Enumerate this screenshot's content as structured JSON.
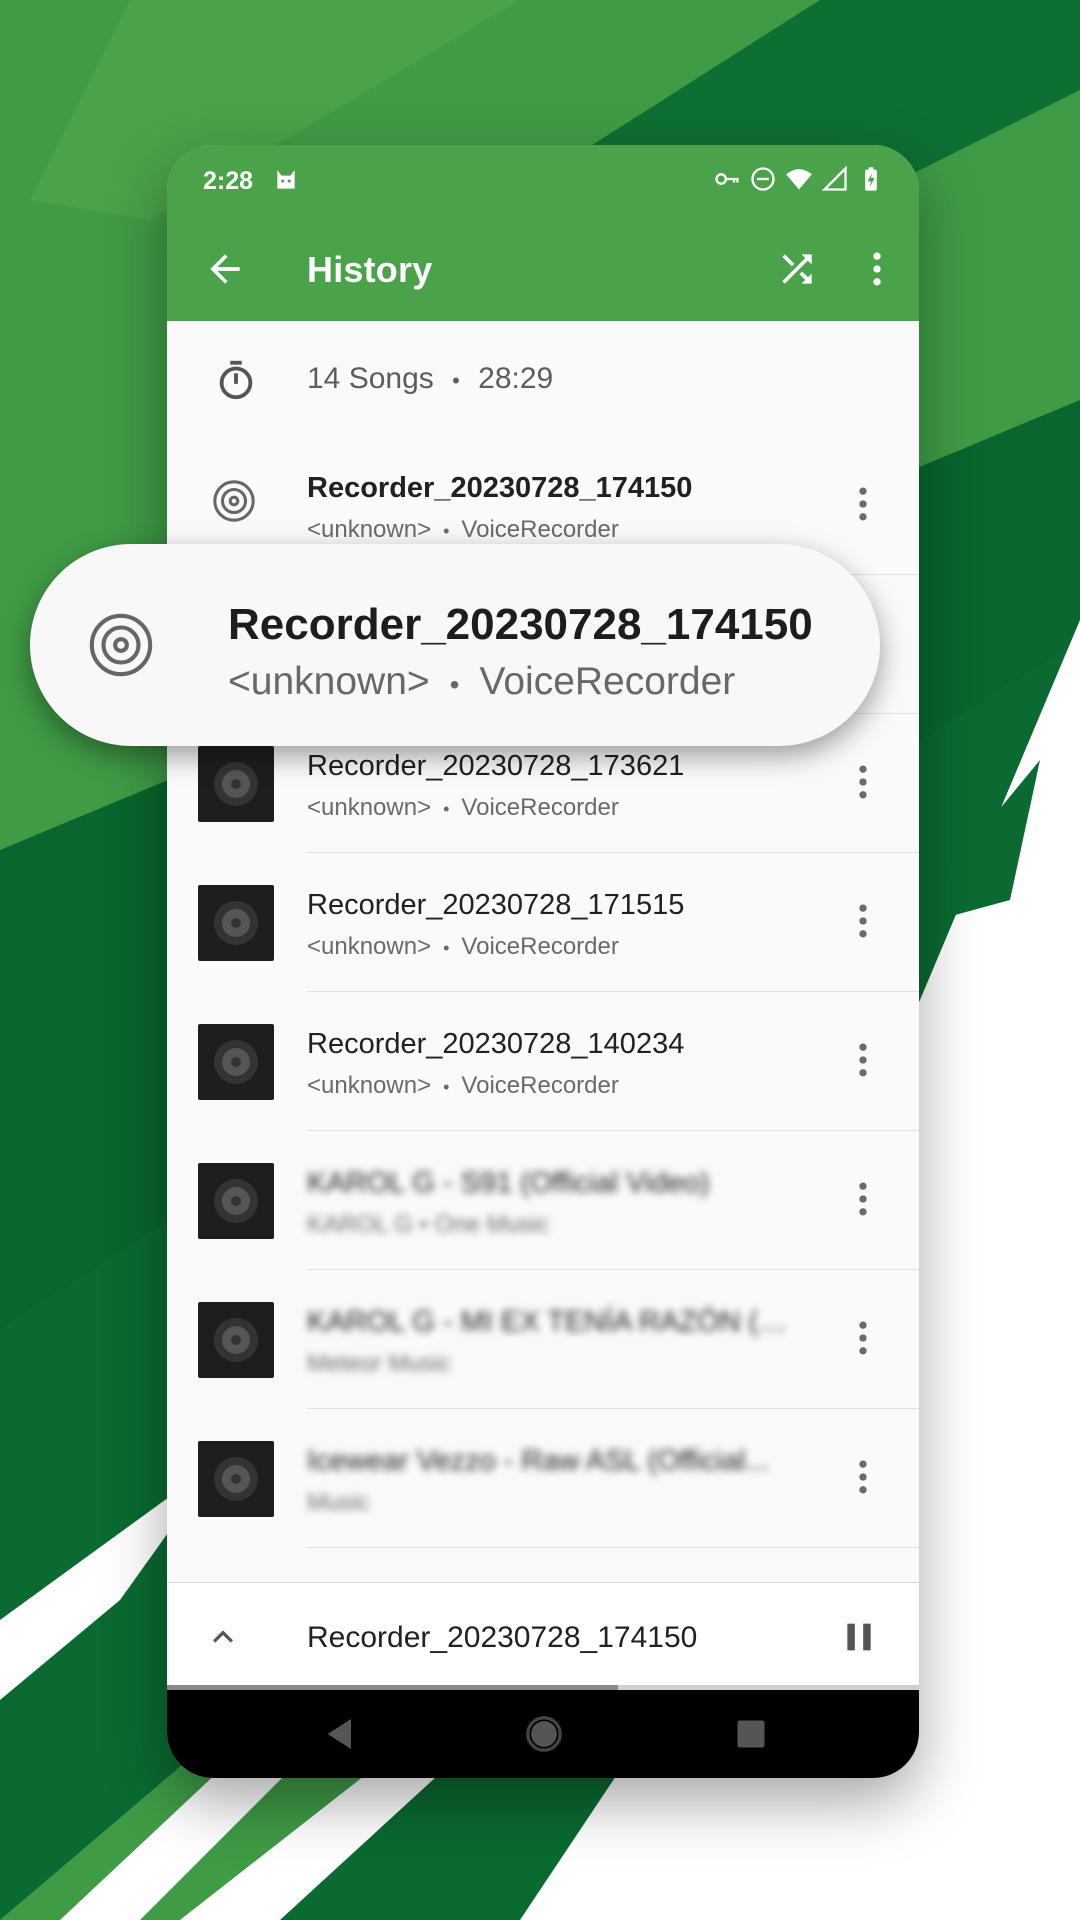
{
  "status_bar": {
    "time": "2:28"
  },
  "app_bar": {
    "title": "History"
  },
  "summary": {
    "songs": "14 Songs",
    "separator": "•",
    "duration": "28:29"
  },
  "separator": "•",
  "songs": [
    {
      "title": "Recorder_20230728_174150",
      "artist": "<unknown>",
      "album": "VoiceRecorder",
      "blurred": false
    },
    {
      "title": "Recorder_20230728_173621",
      "artist": "<unknown>",
      "album": "VoiceRecorder",
      "blurred": false
    },
    {
      "title": "Recorder_20230728_171515",
      "artist": "<unknown>",
      "album": "VoiceRecorder",
      "blurred": false
    },
    {
      "title": "Recorder_20230728_140234",
      "artist": "<unknown>",
      "album": "VoiceRecorder",
      "blurred": false
    },
    {
      "title": "KAROL G - S91 (Official Video)",
      "subtitle": "KAROL G • One Music",
      "blurred": true
    },
    {
      "title": "KAROL G - MI EX TENÍA RAZÓN (O...",
      "subtitle": "Meteor Music",
      "blurred": true
    },
    {
      "title": "Icewear Vezzo - Raw ASL (Official...",
      "subtitle": "Music",
      "blurred": true
    }
  ],
  "callout": {
    "title": "Recorder_20230728_174150",
    "artist": "<unknown>",
    "album": "VoiceRecorder"
  },
  "mini_player": {
    "title": "Recorder_20230728_174150",
    "progress": 0.6
  },
  "colors": {
    "accent": "#4aa24a",
    "dark_green": "#096b30",
    "mid_green": "#3f9b46"
  }
}
